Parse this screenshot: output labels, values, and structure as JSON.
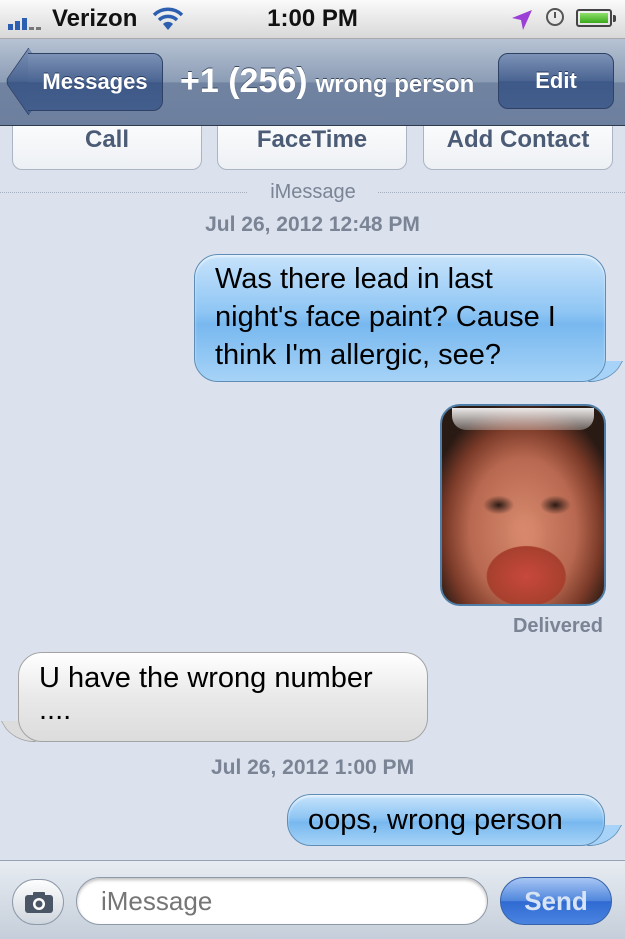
{
  "status_bar": {
    "carrier": "Verizon",
    "time": "1:00 PM"
  },
  "nav": {
    "back_label": "Messages",
    "title_number": "+1 (256)",
    "title_subtitle": "wrong person",
    "edit_label": "Edit"
  },
  "actions": {
    "call": "Call",
    "facetime": "FaceTime",
    "add_contact": "Add Contact"
  },
  "thread": {
    "service_label": "iMessage",
    "timestamp_1": "Jul 26, 2012 12:48 PM",
    "msg_1_line1": "Was there lead in last",
    "msg_1_line2": "night's face paint? Cause I",
    "msg_1_line3": "think I'm allergic, see?",
    "delivered": "Delivered",
    "msg_2_line1": "U have the wrong number",
    "msg_2_line2": "....",
    "timestamp_2": "Jul 26, 2012 1:00 PM",
    "msg_3": "oops, wrong person"
  },
  "composer": {
    "placeholder": "iMessage",
    "send_label": "Send"
  },
  "icons": {
    "camera": "camera-icon",
    "wifi": "wifi-icon",
    "location": "location-arrow-icon",
    "alarm": "alarm-clock-icon",
    "battery": "battery-icon",
    "signal": "signal-bars-icon"
  },
  "colors": {
    "outgoing_bubble": "#8fc6f4",
    "incoming_bubble": "#e9e9e9",
    "nav_bar": "#7083a1",
    "send_button": "#2f6ad2"
  }
}
